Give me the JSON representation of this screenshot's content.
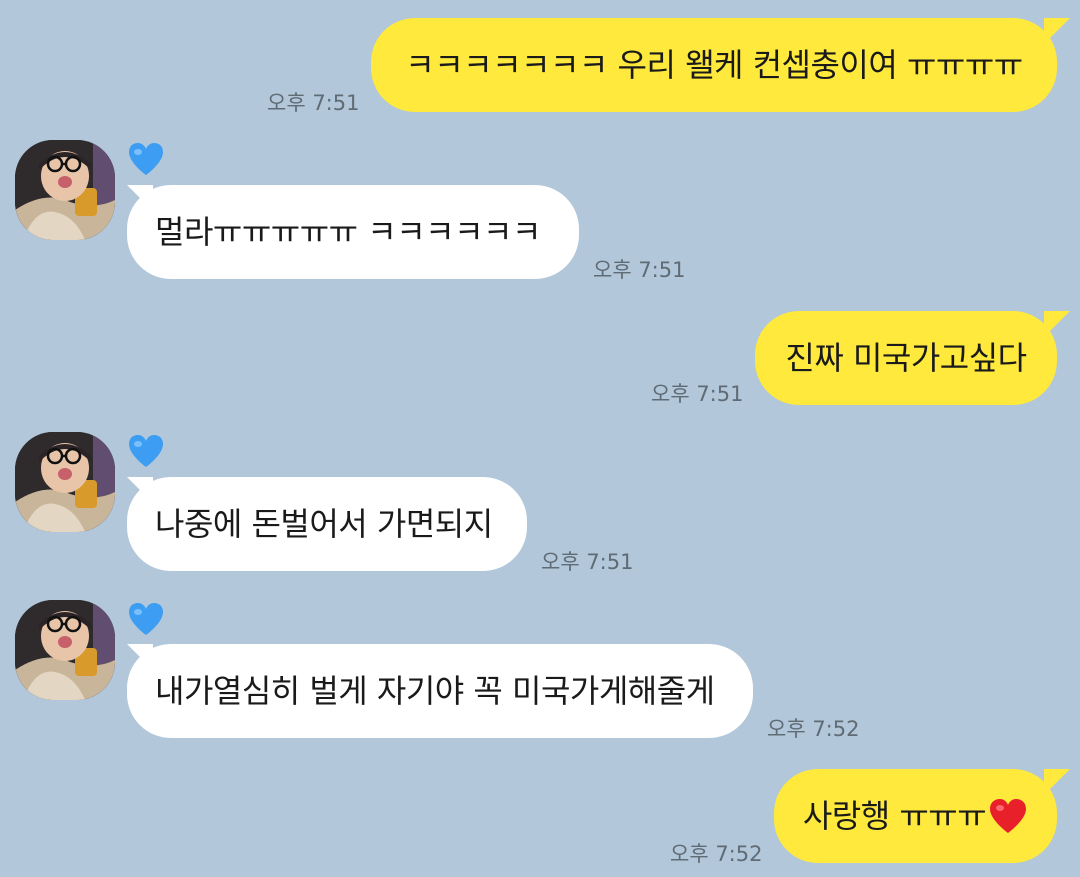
{
  "messages": [
    {
      "sender": "me",
      "text": "ㅋㅋㅋㅋㅋㅋㅋ 우리 왤케 컨셉충이여 ㅠㅠㅠㅠ",
      "time": "오후 7:51"
    },
    {
      "sender": "other",
      "text": "멀라ㅠㅠㅠㅠㅠ ㅋㅋㅋㅋㅋㅋ",
      "time": "오후 7:51",
      "status_icon": "blue-heart-icon"
    },
    {
      "sender": "me",
      "text": "진짜 미국가고싶다",
      "time": "오후 7:51"
    },
    {
      "sender": "other",
      "text": "나중에 돈벌어서 가면되지",
      "time": "오후 7:51",
      "status_icon": "blue-heart-icon"
    },
    {
      "sender": "other",
      "text": "내가열심히 벌게 자기야 꼭 미국가게해줄게",
      "time": "오후 7:52",
      "status_icon": "blue-heart-icon"
    },
    {
      "sender": "me",
      "text": "사랑행 ㅠㅠㅠ",
      "time": "오후 7:52",
      "emoji": "red-heart-icon"
    }
  ],
  "colors": {
    "background": "#b2c7d9",
    "my_bubble": "#fee93c",
    "their_bubble": "#ffffff",
    "time_text": "#5f6b75",
    "status_heart": "#3d9df3",
    "emoji_heart": "#e8202a"
  }
}
